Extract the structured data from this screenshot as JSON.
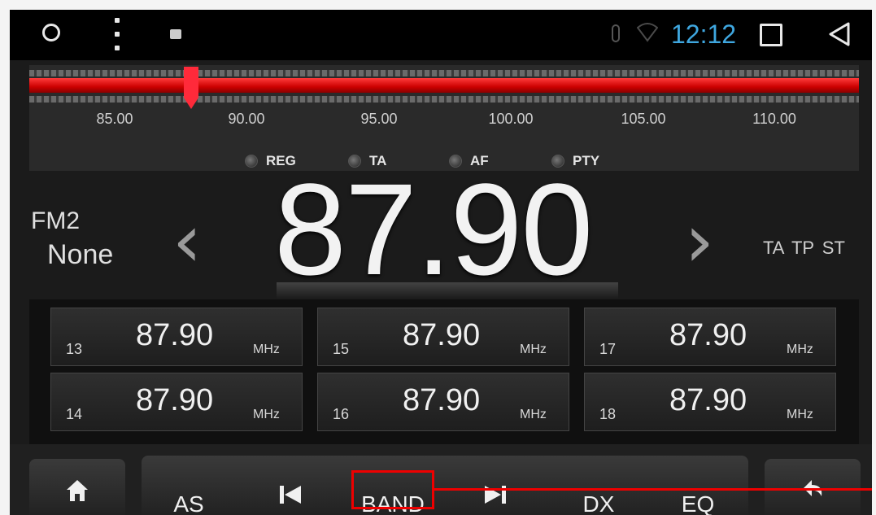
{
  "status_bar": {
    "time": "12:12",
    "icons": [
      "circle-icon",
      "menu-dots-icon",
      "image-icon",
      "bluetooth-icon",
      "wifi-icon",
      "square-icon",
      "back-triangle-icon"
    ]
  },
  "tuner": {
    "scale_labels": [
      "85.00",
      "90.00",
      "95.00",
      "100.00",
      "105.00",
      "110.00"
    ],
    "options": [
      "REG",
      "TA",
      "AF",
      "PTY"
    ]
  },
  "station": {
    "band": "FM2",
    "name": "None",
    "frequency": "87.90",
    "flags": "TA TP ST"
  },
  "presets": [
    {
      "num": "13",
      "freq": "87.90",
      "unit": "MHz"
    },
    {
      "num": "15",
      "freq": "87.90",
      "unit": "MHz"
    },
    {
      "num": "17",
      "freq": "87.90",
      "unit": "MHz"
    },
    {
      "num": "14",
      "freq": "87.90",
      "unit": "MHz"
    },
    {
      "num": "16",
      "freq": "87.90",
      "unit": "MHz"
    },
    {
      "num": "18",
      "freq": "87.90",
      "unit": "MHz"
    }
  ],
  "bottom_bar": {
    "as": "AS",
    "band": "BAND",
    "dx": "DX",
    "eq": "EQ"
  },
  "colors": {
    "accent_blue": "#3fa7e0",
    "tuner_red": "#d40000",
    "highlight_red": "#e00000"
  }
}
